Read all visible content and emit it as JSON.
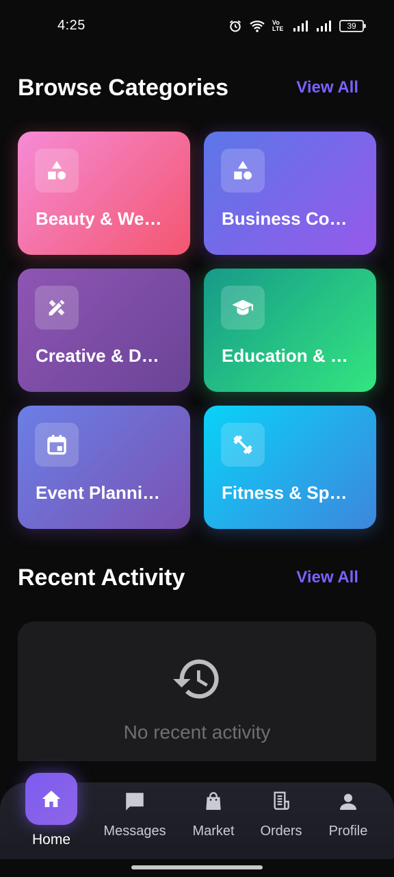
{
  "status_bar": {
    "time": "4:25",
    "battery": "39",
    "network_label": "Vo LTE"
  },
  "browse": {
    "title": "Browse Categories",
    "view_all": "View All"
  },
  "categories": [
    {
      "label": "Beauty & We…",
      "icon": "shapes-icon",
      "gradient": [
        "#f58bd6",
        "#f4566f"
      ]
    },
    {
      "label": "Business Co…",
      "icon": "shapes-icon",
      "gradient": [
        "#5b77e8",
        "#9659ea"
      ]
    },
    {
      "label": "Creative & D…",
      "icon": "design-tools-icon",
      "gradient": [
        "#8f55b4",
        "#6a4496"
      ]
    },
    {
      "label": "Education & …",
      "icon": "graduation-cap-icon",
      "gradient": [
        "#179a8a",
        "#33e57f"
      ]
    },
    {
      "label": "Event Planni…",
      "icon": "calendar-icon",
      "gradient": [
        "#6a7fe6",
        "#7a52b2"
      ]
    },
    {
      "label": "Fitness & Sp…",
      "icon": "dumbbell-icon",
      "gradient": [
        "#09d2f8",
        "#3e86dd"
      ]
    }
  ],
  "recent": {
    "title": "Recent Activity",
    "view_all": "View All",
    "empty_text": "No recent activity"
  },
  "nav": {
    "home": "Home",
    "messages": "Messages",
    "market": "Market",
    "orders": "Orders",
    "profile": "Profile",
    "active": "home"
  },
  "colors": {
    "accent": "#7b61ff",
    "background": "#0b0b0c",
    "card_bg": "#1c1c1e"
  }
}
